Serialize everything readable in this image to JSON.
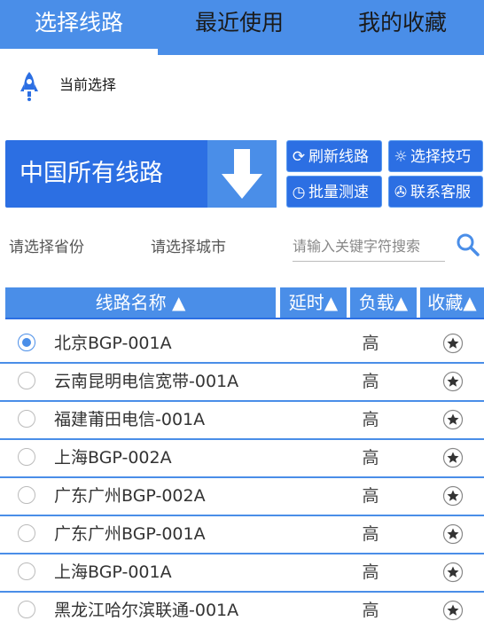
{
  "tabs": [
    {
      "label": "选择线路",
      "active": true
    },
    {
      "label": "最近使用",
      "active": false
    },
    {
      "label": "我的收藏",
      "active": false
    }
  ],
  "current": {
    "label": "当前选择",
    "icon": "rocket-icon"
  },
  "selector": {
    "label": "中国所有线路",
    "icon": "arrow-down-icon"
  },
  "buttons": {
    "refresh": "刷新线路",
    "tips": "选择技巧",
    "batch_test": "批量测速",
    "support": "联系客服"
  },
  "filters": {
    "province_placeholder": "请选择省份",
    "city_placeholder": "请选择城市",
    "search_placeholder": "请输入关键字符搜索"
  },
  "table": {
    "headers": {
      "name": "线路名称 ▲",
      "latency": "延时▲",
      "load": "负载▲",
      "favorite": "收藏▲"
    },
    "rows": [
      {
        "name": "北京BGP-001A",
        "load": "高",
        "selected": true
      },
      {
        "name": "云南昆明电信宽带-001A",
        "load": "高",
        "selected": false
      },
      {
        "name": "福建莆田电信-001A",
        "load": "高",
        "selected": false
      },
      {
        "name": "上海BGP-002A",
        "load": "高",
        "selected": false
      },
      {
        "name": "广东广州BGP-002A",
        "load": "高",
        "selected": false
      },
      {
        "name": "广东广州BGP-001A",
        "load": "高",
        "selected": false
      },
      {
        "name": "上海BGP-001A",
        "load": "高",
        "selected": false
      },
      {
        "name": "黑龙江哈尔滨联通-001A",
        "load": "高",
        "selected": false
      }
    ]
  },
  "colors": {
    "primary": "#4a8ee8",
    "primary_dark": "#2c6fe3"
  }
}
